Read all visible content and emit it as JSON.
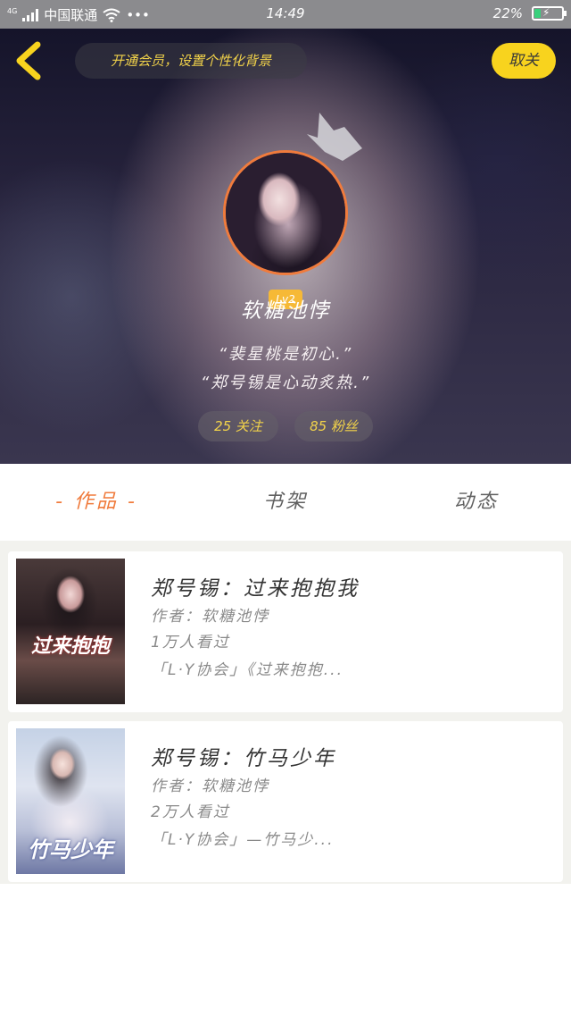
{
  "status_bar": {
    "network_small": "4G",
    "carrier": "中国联通",
    "time": "14:49",
    "battery_percent": "22%",
    "battery_level": 0.22,
    "more": "•••"
  },
  "header": {
    "vip_banner": "开通会员，设置个性化背景",
    "unfollow_label": "取关",
    "level": "Lv2",
    "username": "软糖池悖",
    "bio_line_1": "“裴星桃是初心.”",
    "bio_line_2": "“郑号锡是心动炙热.”",
    "following": "25 关注",
    "fans": "85 粉丝"
  },
  "tabs": {
    "works": "- 作品 -",
    "bookshelf": "书架",
    "feed": "动态"
  },
  "books": [
    {
      "title": "郑号锡：过来抱抱我",
      "author": "作者：软糖池悖",
      "views": "1万人看过",
      "description": "「L·Y协会」《过来抱抱...",
      "cover_text": "过来抱抱"
    },
    {
      "title": "郑号锡：竹马少年",
      "author": "作者：软糖池悖",
      "views": "2万人看过",
      "description": "「L·Y协会」—竹马少...",
      "cover_text": "竹马少年"
    }
  ],
  "colors": {
    "accent_orange": "#f07b3c",
    "accent_yellow": "#f8d31e",
    "banner_text": "#f2d34a"
  }
}
